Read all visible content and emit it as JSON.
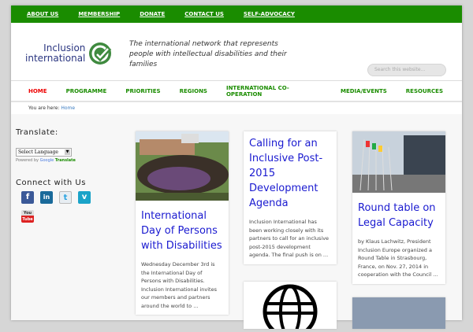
{
  "topbar": [
    "ABOUT US",
    "MEMBERSHIP",
    "DONATE",
    "CONTACT US",
    "SELF-ADVOCACY"
  ],
  "logo": {
    "line1": "Inclusion",
    "line2": "international"
  },
  "tagline": "The international network that represents people with intellectual disabilities and their families",
  "search": {
    "placeholder": "Search this website..."
  },
  "nav": [
    "HOME",
    "PROGRAMME",
    "PRIORITIES",
    "REGIONS",
    "INTERNATIONAL CO-OPERATION",
    "MEDIA/EVENTS",
    "RESOURCES"
  ],
  "breadcrumb": {
    "label": "You are here:",
    "link": "Home"
  },
  "sidebar": {
    "translate_title": "Translate:",
    "select_value": "Select Language",
    "powered_by": "Powered by",
    "google": "Google",
    "translate": "Translate",
    "connect_title": "Connect with Us"
  },
  "cards": [
    {
      "title": "International Day of Persons with Disabilities",
      "excerpt": "Wednesday December 3rd is the International Day of Persons with Disabilities. Inclusion International invites our members and partners around the world to ..."
    },
    {
      "title": "Calling for an Inclusive Post-2015 Development Agenda",
      "excerpt": "Inclusion International has been working closely with its partners to call for an inclusive post-2015 development agenda.  The final push is on ..."
    },
    {
      "title": "Round table on Legal Capacity",
      "excerpt": "by Klaus Lachwitz, President Inclusion Europe organized a Round Table in Strasbourg, France, on Nov. 27, 2014 in cooperation with the Council ..."
    }
  ]
}
